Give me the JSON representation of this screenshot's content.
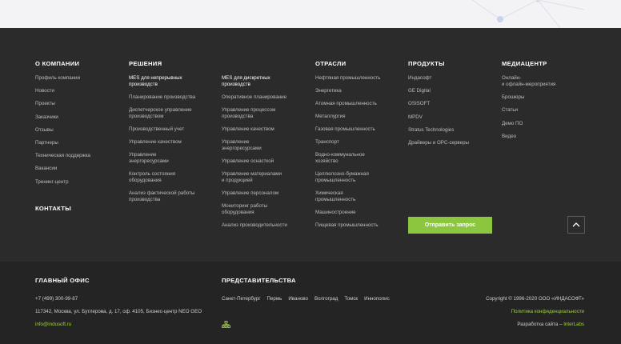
{
  "columns": [
    {
      "heading": "О КОМПАНИИ",
      "items": [
        "Профиль компании",
        "Новости",
        "Проекты",
        "Заказчики",
        "Отзывы",
        "Партнеры",
        "Техническая поддержка",
        "Вакансии",
        "Тренинг-центр"
      ]
    },
    {
      "heading": "РЕШЕНИЯ",
      "items": [
        "MES для непрерывных\nпроизводств",
        "Планирование производства",
        "Диспетчерское управление\nпроизводством",
        "Производственный учет",
        "Управление качеством",
        "Управление\nэнергоресурсами",
        "Контроль состояния\nоборудования",
        "Анализ фактической работы\nпроизводства"
      ]
    },
    {
      "heading": "",
      "items": [
        "MES для дискретных\nпроизводств",
        "Оперативное планирование",
        "Управление процессом\nпроизводства",
        "Управление качеством",
        "Управление\nэнергоресурсами",
        "Управление оснасткой",
        "Управление материалами\nи продукцией",
        "Управление персоналом",
        "Мониторинг работы\nоборудования",
        "Анализ производительности"
      ]
    },
    {
      "heading": "ОТРАСЛИ",
      "items": [
        "Нефтяная промышленность",
        "Энергетика",
        "Атомная промышленность",
        "Металлургия",
        "Газовая промышленность",
        "Транспорт",
        "Водно-коммунальное\nхозяйство",
        "Целлюлозно-бумажная\nпромышленность",
        "Химическая\nпромышленность",
        "Машиностроение",
        "Пищевая промышленность"
      ]
    },
    {
      "heading": "ПРОДУКТЫ",
      "items": [
        "Индасофт",
        "GE Digital",
        "OSISOFT",
        "MPDV",
        "Stratus Technologies",
        "Драйверы и OPC-серверы"
      ]
    },
    {
      "heading": "МЕДИАЦЕНТР",
      "items": [
        "Онлайн-\nи офлайн-мероприятия",
        "Брошюры",
        "Статьи",
        "Демо ПО",
        "Видео"
      ]
    }
  ],
  "contacts_heading": "КОНТАКТЫ",
  "submit_label": "Отправить запрос",
  "office": {
    "heading": "ГЛАВНЫЙ ОФИС",
    "phone": "+7 (499) 300-99-87",
    "address": "117342, Москва, ул. Бутлерова, д. 17, оф. 4105, Бизнес-центр NEO GEO",
    "email": "info@indusoft.ru"
  },
  "branches": {
    "heading": "ПРЕДСТАВИТЕЛЬСТВА",
    "cities": [
      "Санкт-Петербург",
      "Пермь",
      "Иваново",
      "Волгоград",
      "Томск",
      "Иннополис"
    ]
  },
  "legal": {
    "copyright": "Copyright © 1996-2020 ООО «ИНДАСОФТ»",
    "privacy": "Политика конфиденциальности",
    "dev_prefix": "Разработка сайта –",
    "dev_name": "InterLabs"
  },
  "colors": {
    "accent": "#8cc63f",
    "link": "#9fd13d",
    "bg": "#2b2b2b",
    "bg_bottom": "#242424"
  }
}
